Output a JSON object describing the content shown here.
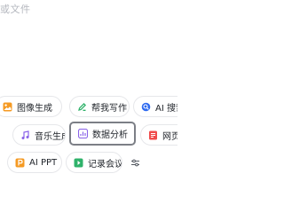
{
  "input": {
    "placeholder_fragment": "或文件"
  },
  "chips_row1": [
    {
      "label": "图像生成",
      "icon": "image-icon",
      "color": "#f59a23"
    },
    {
      "label": "帮我写作",
      "icon": "pen-icon",
      "color": "#2fb26a"
    },
    {
      "label": "AI 搜索",
      "icon": "search-icon",
      "color": "#2f6bf0"
    }
  ],
  "chips_row2": [
    {
      "label": "音乐生成",
      "icon": "music-icon",
      "color": "#8a63e8"
    },
    {
      "label": "数据分析",
      "icon": "chart-icon",
      "color": "#8a63e8",
      "selected": true
    },
    {
      "label": "网页摘",
      "icon": "doc-icon",
      "color": "#f04b4b"
    }
  ],
  "chips_row3": [
    {
      "label": "AI PPT",
      "icon": "ppt-icon",
      "color": "#f59a23"
    },
    {
      "label": "记录会议",
      "icon": "mic-icon",
      "color": "#2fb26a"
    },
    {
      "label": "",
      "icon": "sliders-icon",
      "color": "#555a62"
    }
  ],
  "colors": {
    "chip_border": "#e6e7ea",
    "selected_border": "#7c7f86",
    "text": "#1f2329",
    "placeholder": "#b5b8bf"
  }
}
